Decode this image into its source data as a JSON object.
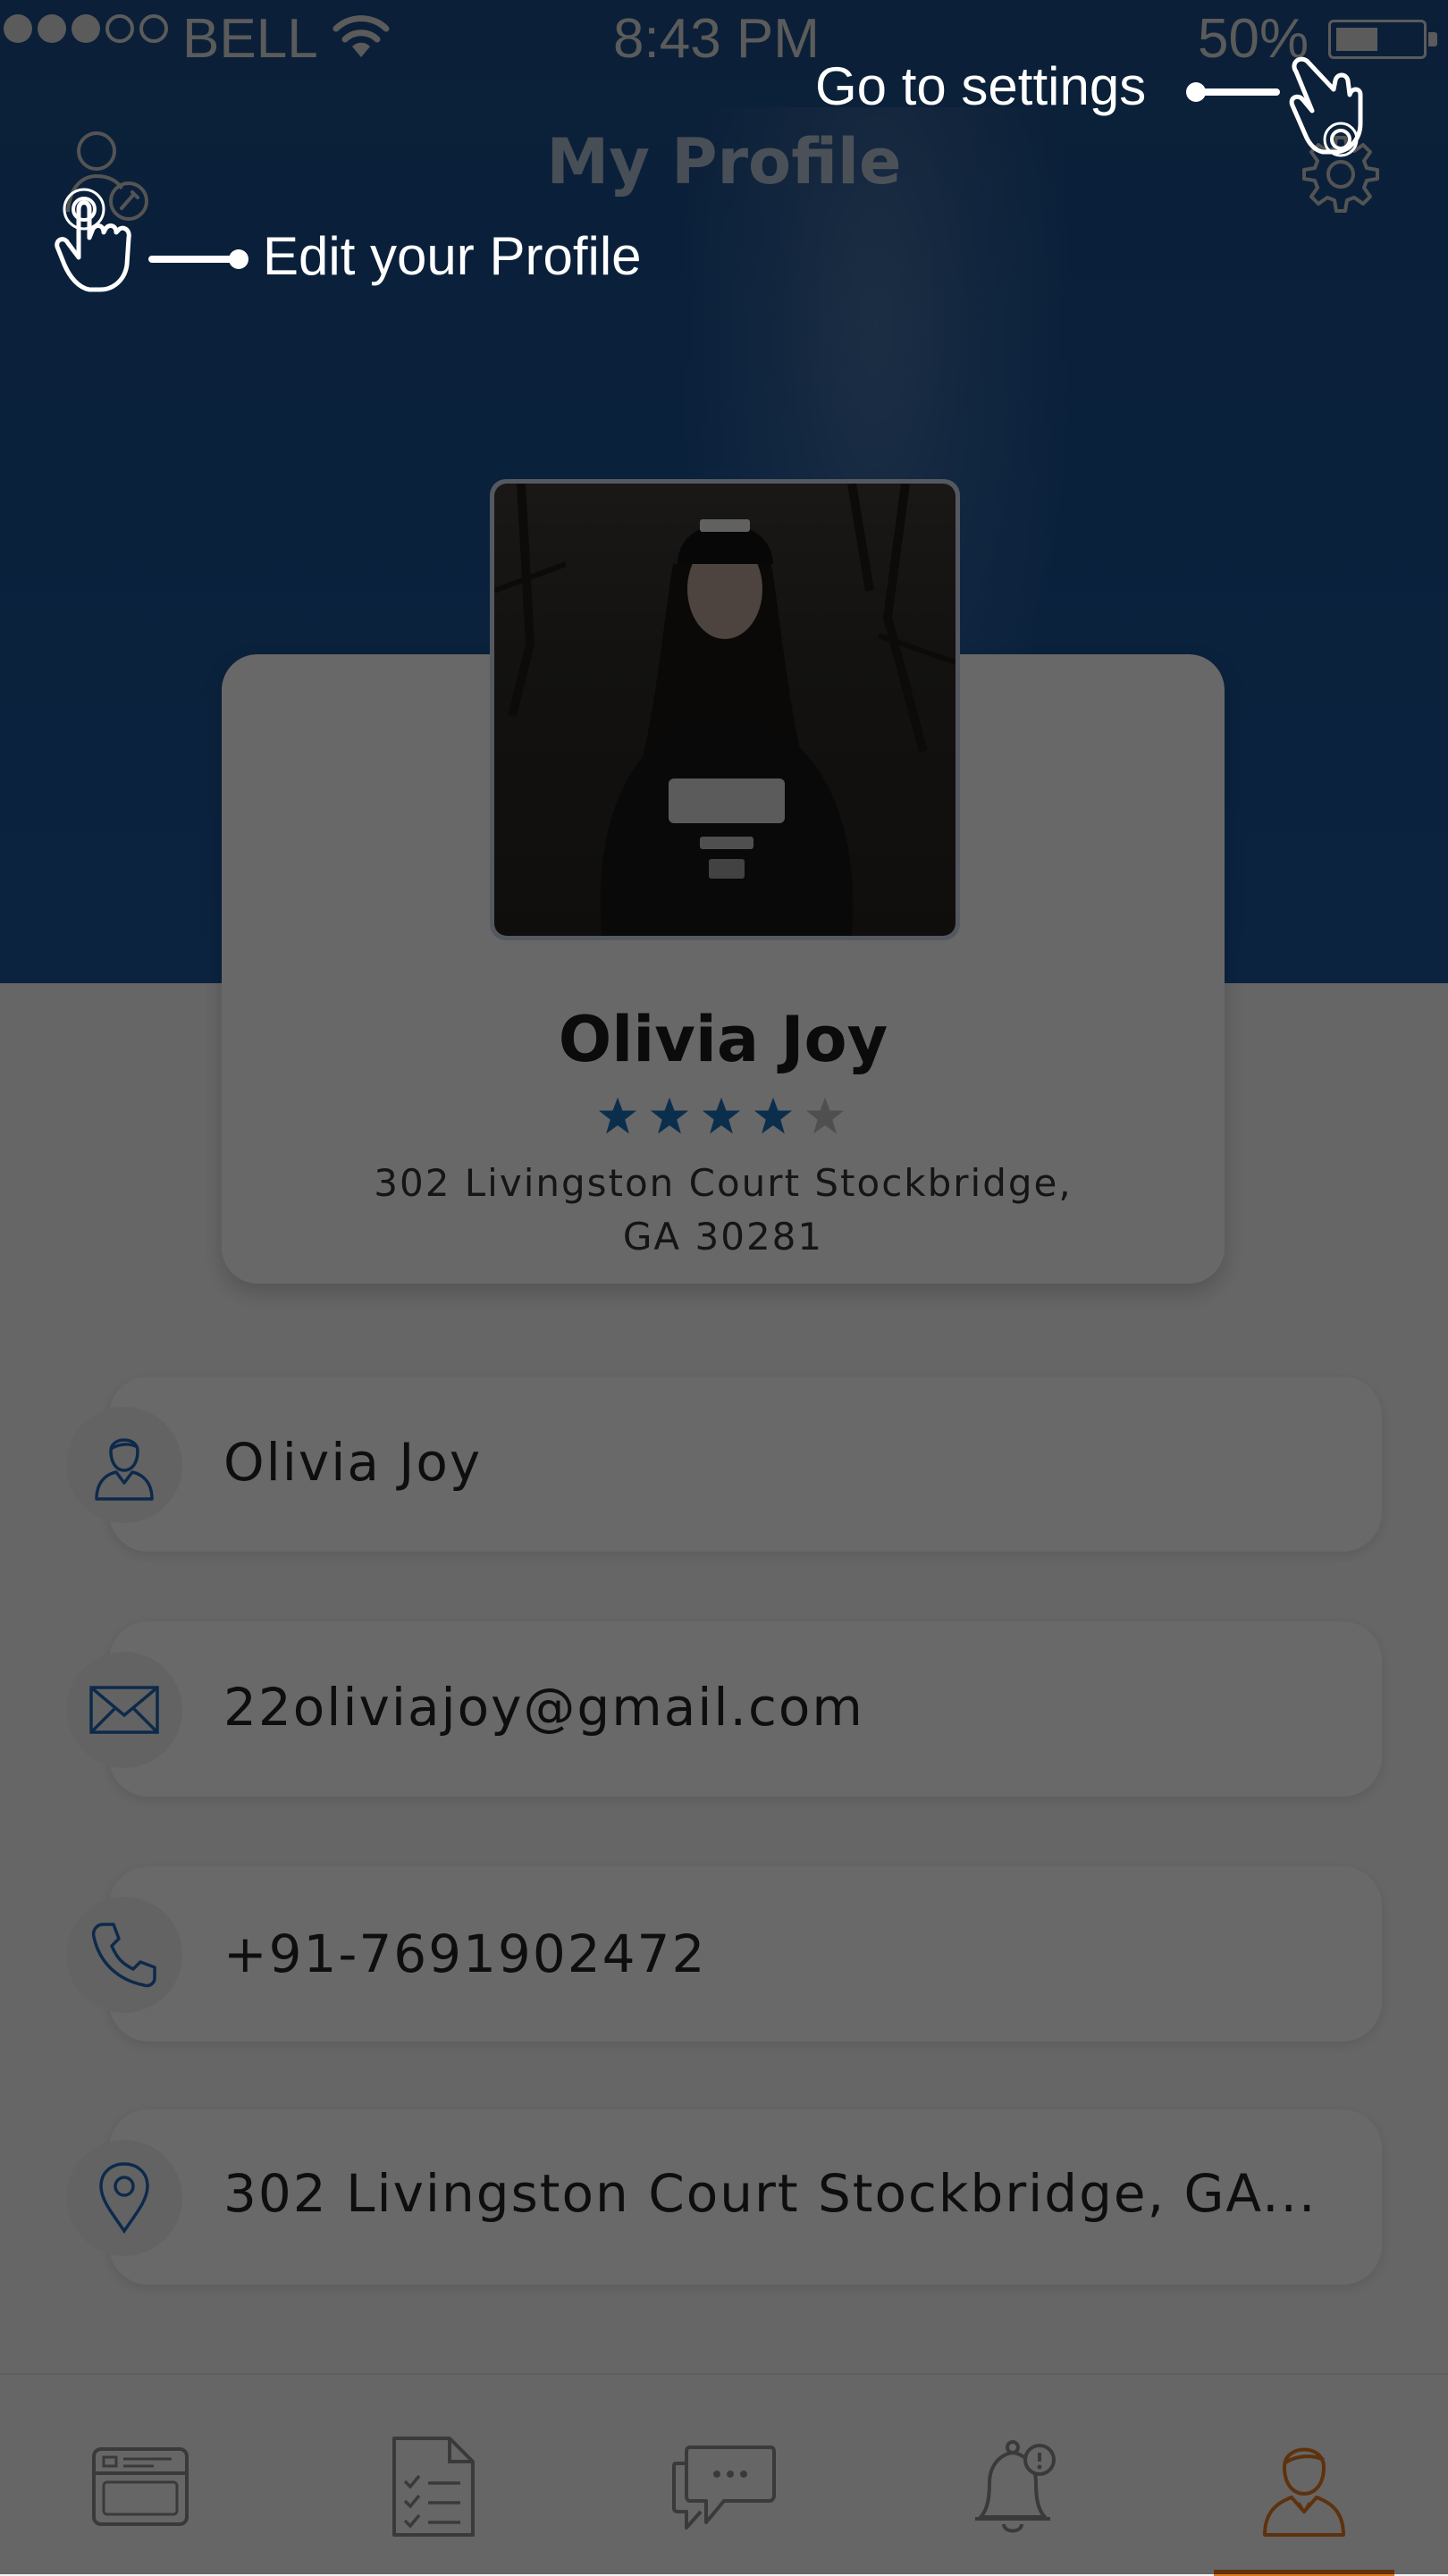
{
  "status_bar": {
    "carrier": "BELL",
    "time": "8:43 PM",
    "battery_percent": "50%",
    "battery_level": 0.5,
    "signal_bars_filled": 3,
    "signal_bars_total": 5
  },
  "header": {
    "title": "My Profile"
  },
  "hints": {
    "settings": "Go to settings",
    "edit_profile": "Edit your Profile"
  },
  "profile": {
    "name": "Olivia Joy",
    "rating": 4,
    "rating_max": 5,
    "address_line1": "302 Livingston Court Stockbridge,",
    "address_line2": "GA 30281"
  },
  "details": {
    "name": "Olivia Joy",
    "email": "22oliviajoy@gmail.com",
    "phone": "+91-7691902472",
    "address": "302 Livingston Court Stockbridge, GA..."
  },
  "nav": {
    "items": [
      "dashboard-icon",
      "tasks-icon",
      "messages-icon",
      "notifications-icon",
      "profile-icon"
    ],
    "active_index": 4
  },
  "colors": {
    "header_blue": "#1b4b86",
    "accent_orange": "#e07820",
    "star_blue": "#1e6fb8",
    "star_grey": "#bdbdbd",
    "icon_blue": "#1f64b4"
  }
}
